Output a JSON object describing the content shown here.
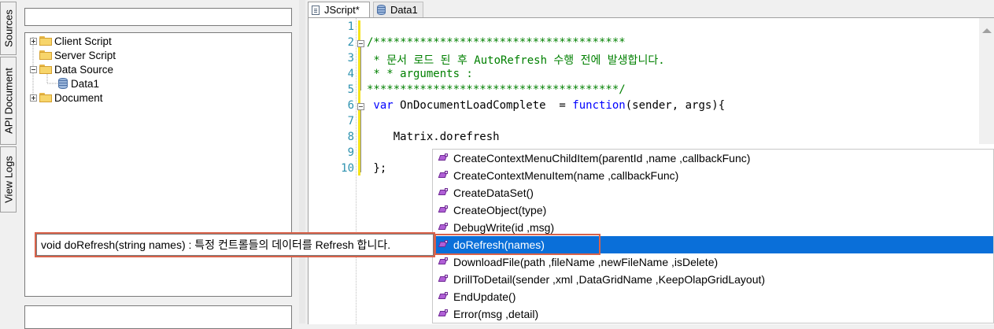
{
  "side_tabs": [
    "Sources",
    "API Document",
    "View Logs"
  ],
  "explorer": {
    "search_value": "",
    "tree": [
      {
        "label": "Client Script",
        "type": "folder",
        "expander": "plus"
      },
      {
        "label": "Server Script",
        "type": "folder",
        "expander": "none"
      },
      {
        "label": "Data Source",
        "type": "folder",
        "expander": "minus"
      },
      {
        "label": "Data1",
        "type": "database",
        "expander": "none"
      },
      {
        "label": "Document",
        "type": "folder",
        "expander": "plus"
      }
    ]
  },
  "editor": {
    "tabs": [
      {
        "label": "JScript*",
        "icon": "document-icon",
        "active": true
      },
      {
        "label": "Data1",
        "icon": "database-icon",
        "active": false
      }
    ],
    "line_numbers": [
      "1",
      "2",
      "3",
      "4",
      "5",
      "6",
      "7",
      "8",
      "9",
      "10"
    ],
    "lines": [
      {
        "tokens": [
          {
            "t": ""
          }
        ]
      },
      {
        "tokens": [
          {
            "t": "/**************************************",
            "c": "cm"
          }
        ]
      },
      {
        "tokens": [
          {
            "t": " * 문서 로드 된 후 AutoRefresh 수행 전에 발생합니다.",
            "c": "cm"
          }
        ]
      },
      {
        "tokens": [
          {
            "t": " * * arguments :",
            "c": "cm"
          }
        ]
      },
      {
        "tokens": [
          {
            "t": "**************************************/",
            "c": "cm"
          }
        ]
      },
      {
        "tokens": [
          {
            "t": " var",
            "c": "kw"
          },
          {
            "t": " OnDocumentLoadComplete  = "
          },
          {
            "t": "function",
            "c": "kw"
          },
          {
            "t": "(sender, args){"
          }
        ]
      },
      {
        "tokens": [
          {
            "t": ""
          }
        ]
      },
      {
        "tokens": [
          {
            "t": "    Matrix.dorefresh"
          }
        ]
      },
      {
        "tokens": [
          {
            "t": ""
          }
        ]
      },
      {
        "tokens": [
          {
            "t": " };"
          }
        ]
      }
    ]
  },
  "completion": {
    "selected_index": 5,
    "items": [
      "CreateContextMenuChildItem(parentId ,name ,callbackFunc)",
      "CreateContextMenuItem(name ,callbackFunc)",
      "CreateDataSet()",
      "CreateObject(type)",
      "DebugWrite(id ,msg)",
      "doRefresh(names)",
      "DownloadFile(path ,fileName ,newFileName ,isDelete)",
      "DrillToDetail(sender ,xml ,DataGridName ,KeepOlapGridLayout)",
      "EndUpdate()",
      "Error(msg ,detail)"
    ],
    "tooltip": "void doRefresh(string names) : 특정 컨트롤들의 데이터를 Refresh 합니다."
  },
  "colors": {
    "comment": "#008000",
    "keyword": "#0000ff",
    "line_number": "#2b91af",
    "selection": "#0a6fd9",
    "highlight_outline": "#d9624a"
  }
}
